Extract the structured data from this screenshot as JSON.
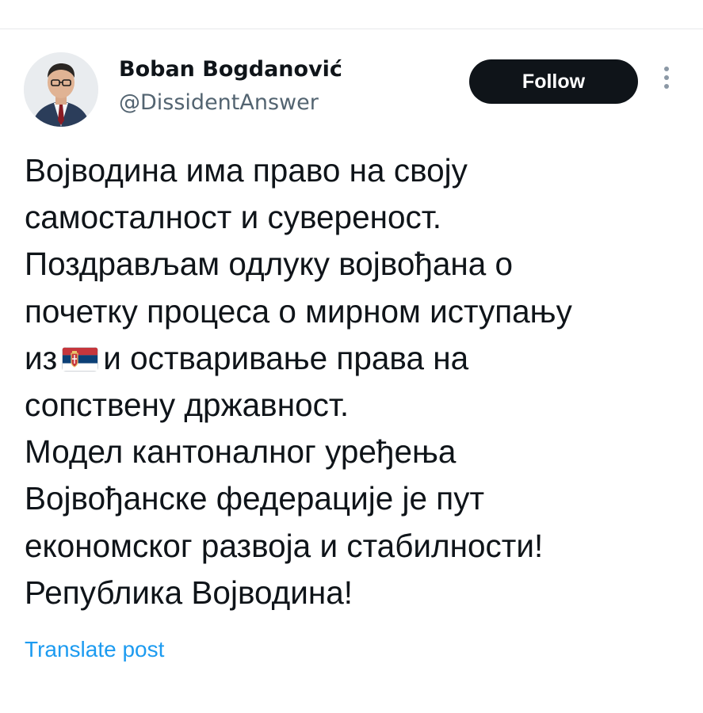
{
  "author": {
    "display_name": "Boban Bogdanović",
    "handle": "@DissidentAnswer",
    "avatar_icon": "profile-photo"
  },
  "follow_button": {
    "label": "Follow"
  },
  "more_menu": {
    "icon": "vertical-ellipsis-icon"
  },
  "tweet": {
    "lines": [
      "Војводина има право на своју",
      "самосталност и сувереност.",
      "Поздрављам одлуку војвођана о",
      "почетку процеса о мирном иступању",
      "из",
      "и остваривање права на",
      "сопствену државност.",
      "Модел кантоналног уређења",
      "Војвођанске федерације је пут",
      "економског развоја и стабилности!",
      "Република Војводина!"
    ],
    "emoji": "serbia-flag-emoji"
  },
  "translate": {
    "label": "Translate post"
  },
  "colors": {
    "text": "#0f1419",
    "secondary": "#536471",
    "link": "#1d9bf0",
    "button_bg": "#0f1419",
    "flag_red": "#c6363c",
    "flag_blue": "#0c4076",
    "flag_white": "#ffffff"
  }
}
